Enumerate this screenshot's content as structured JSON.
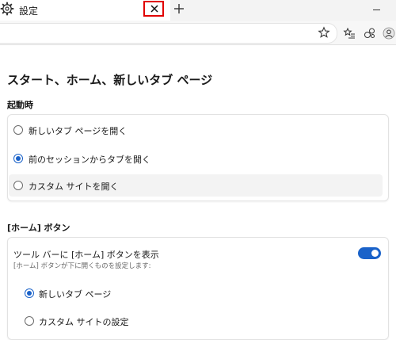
{
  "tab": {
    "title": "設定",
    "icon": "gear-icon",
    "close_icon": "close-icon",
    "highlight_color": "#e10000"
  },
  "window": {
    "new_tab_icon": "plus-icon",
    "minimize_icon": "minimize-icon"
  },
  "toolbar": {
    "icons": [
      "star-icon",
      "favorites-icon",
      "extensions-icon",
      "profile-icon"
    ]
  },
  "page": {
    "title": "スタート、ホーム、新しいタブ ページ"
  },
  "startup": {
    "heading": "起動時",
    "options": [
      {
        "label": "新しいタブ ページを開く",
        "checked": false
      },
      {
        "label": "前のセッションからタブを開く",
        "checked": true
      },
      {
        "label": "カスタム サイトを開く",
        "checked": false
      }
    ]
  },
  "home_button": {
    "heading": "[ホーム] ボタン",
    "toggle_label": "ツール バーに [ホーム] ボタンを表示",
    "toggle_desc": "[ホーム] ボタンが下に開くものを設定します:",
    "toggle_on": true,
    "options": [
      {
        "label": "新しいタブ ページ",
        "checked": true
      },
      {
        "label": "カスタム サイトの設定",
        "checked": false
      }
    ]
  },
  "colors": {
    "accent": "#1a62c9"
  }
}
